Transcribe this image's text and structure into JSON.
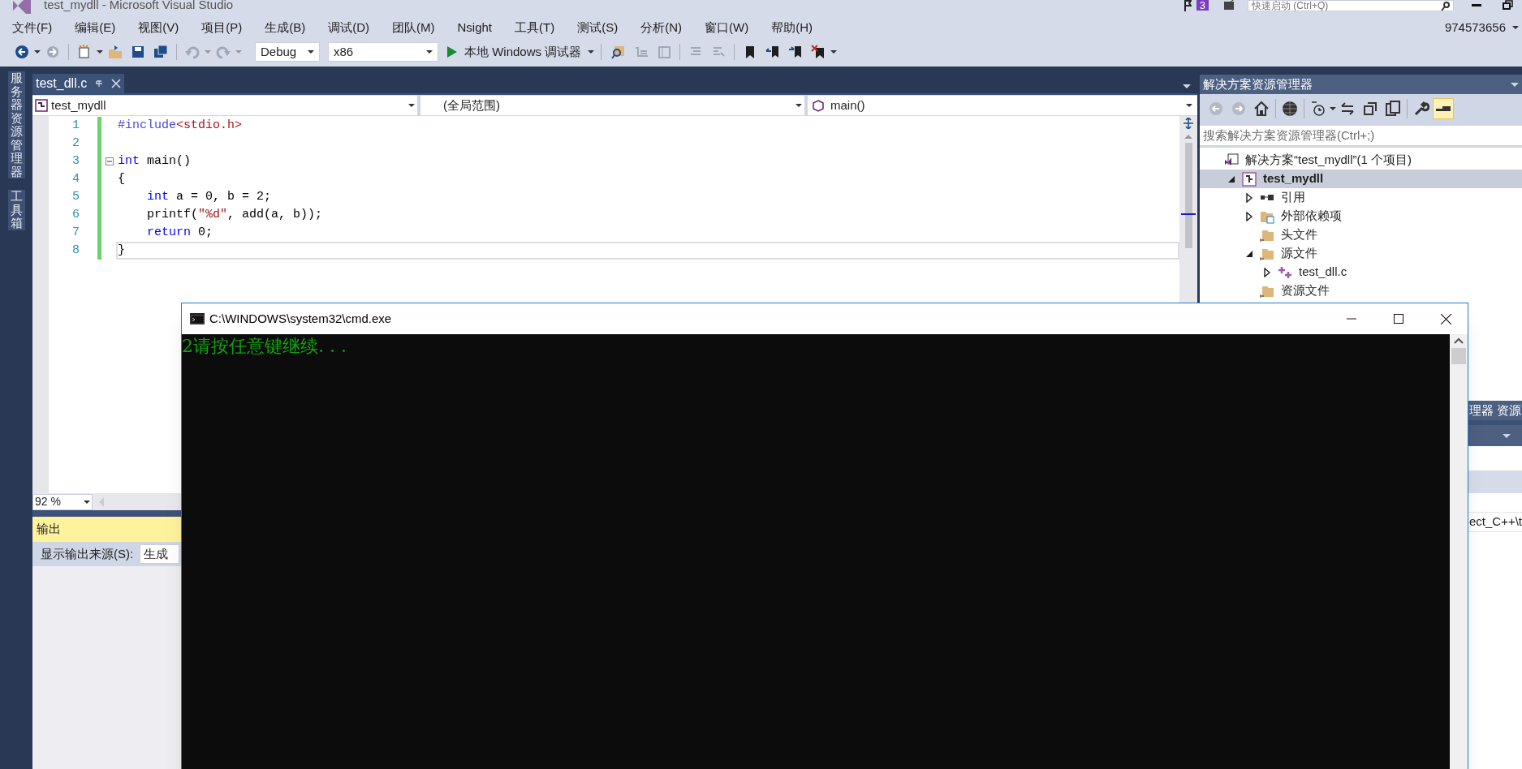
{
  "window": {
    "title": "test_mydll - Microsoft Visual Studio"
  },
  "title_bar": {
    "notification_count": "3",
    "quick_launch_placeholder": "快速启动 (Ctrl+Q)",
    "account": "974573656"
  },
  "menu": [
    "文件(F)",
    "编辑(E)",
    "视图(V)",
    "项目(P)",
    "生成(B)",
    "调试(D)",
    "团队(M)",
    "Nsight",
    "工具(T)",
    "测试(S)",
    "分析(N)",
    "窗口(W)",
    "帮助(H)"
  ],
  "toolbar": {
    "configuration": "Debug",
    "platform": "x86",
    "debugger": "本地 Windows 调试器"
  },
  "side_tabs": [
    "服务器资源管理器",
    "工具箱"
  ],
  "editor": {
    "tabs": [
      {
        "label": "test_dll.c",
        "selected": true
      }
    ],
    "project_dropdown": "test_mydll",
    "scope_dropdown": "(全局范围)",
    "member_dropdown": "main()",
    "lines": [
      {
        "number": "1",
        "fold": false,
        "current": false,
        "tokens": [
          {
            "kind": "directive",
            "text": "#include"
          },
          {
            "kind": "string",
            "text": "<stdio.h>"
          }
        ]
      },
      {
        "number": "2",
        "fold": false,
        "current": false
      },
      {
        "number": "3",
        "fold": true,
        "current": false,
        "tokens": [
          {
            "kind": "keyword",
            "text": "int"
          },
          {
            "kind": "plain",
            "text": " main()"
          }
        ]
      },
      {
        "number": "4",
        "fold": false,
        "current": false,
        "tokens": [
          {
            "kind": "plain",
            "text": "{"
          }
        ]
      },
      {
        "number": "5",
        "fold": false,
        "current": false,
        "tokens": [
          {
            "kind": "keyword",
            "text": "    int"
          },
          {
            "kind": "plain",
            "text": " a = 0, b = 2;"
          }
        ]
      },
      {
        "number": "6",
        "fold": false,
        "current": false,
        "tokens": [
          {
            "kind": "plain",
            "text": "    printf("
          },
          {
            "kind": "string",
            "text": "\"%d\""
          },
          {
            "kind": "plain",
            "text": ", add(a, b));"
          }
        ]
      },
      {
        "number": "7",
        "fold": false,
        "current": false,
        "tokens": [
          {
            "kind": "keyword",
            "text": "    return"
          },
          {
            "kind": "plain",
            "text": " 0;"
          }
        ]
      },
      {
        "number": "8",
        "fold": false,
        "current": true,
        "tokens": [
          {
            "kind": "plain",
            "text": "}"
          }
        ]
      }
    ],
    "zoom": "92 %"
  },
  "output": {
    "title": "输出",
    "source_label": "显示输出来源(S):",
    "source_value": "生成"
  },
  "solution_explorer": {
    "title": "解决方案资源管理器",
    "search_placeholder": "搜索解决方案资源管理器(Ctrl+;)",
    "tree": [
      {
        "label": "解决方案“test_mydll”(1 个项目)",
        "kind": "solution",
        "selected": false,
        "children": [
          {
            "label": "test_mydll",
            "kind": "project",
            "selected": true,
            "expanded": true,
            "children": [
              {
                "label": "引用",
                "kind": "references",
                "selected": false,
                "expanded": false
              },
              {
                "label": "外部依赖项",
                "kind": "external",
                "selected": false,
                "expanded": false
              },
              {
                "label": "头文件",
                "kind": "folder",
                "selected": false
              },
              {
                "label": "源文件",
                "kind": "folder",
                "selected": false,
                "expanded": true,
                "children": [
                  {
                    "label": "test_dll.c",
                    "kind": "source",
                    "selected": false,
                    "expanded": false
                  }
                ]
              },
              {
                "label": "资源文件",
                "kind": "folder",
                "selected": false
              }
            ]
          }
        ]
      }
    ]
  },
  "lower_panel": {
    "tab_label": "理器 资源",
    "path_fragment": "ect_C++\\t"
  },
  "cmd_window": {
    "title": "C:\\WINDOWS\\system32\\cmd.exe",
    "output": "2请按任意键继续. . ."
  }
}
